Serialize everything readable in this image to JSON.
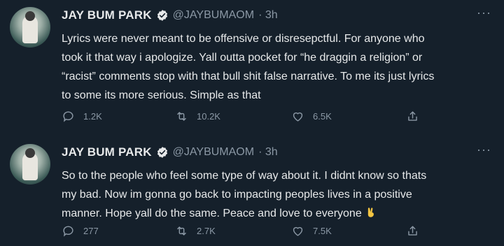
{
  "tweets": [
    {
      "name": "JAY BUM PARK",
      "handle": "@JAYBUMAOM",
      "time": "· 3h",
      "more": "···",
      "lines": [
        "Lyrics were never meant to be offensive or disresepctful. For anyone who",
        "took it that way i apologize. Yall outta pocket for “he draggin a religion” or",
        "“racist” comments stop with that bull shit false narrative. To me its just lyrics",
        "to some its more serious. Simple as that"
      ],
      "replies": "1.2K",
      "retweets": "10.2K",
      "likes": "6.5K"
    },
    {
      "name": "JAY BUM PARK",
      "handle": "@JAYBUMAOM",
      "time": "· 3h",
      "more": "···",
      "lines": [
        "So to the people who feel some type of way about it. I didnt know so thats",
        "my bad. Now im gonna go back to impacting peoples lives in a positive",
        "manner. Hope yall do the same. Peace and love to everyone"
      ],
      "replies": "277",
      "retweets": "2.7K",
      "likes": "7.5K"
    }
  ],
  "icons": {
    "verified": "verified-badge-icon",
    "reply": "reply-icon",
    "retweet": "retweet-icon",
    "like": "heart-icon",
    "share": "share-icon",
    "emoji": "victory-hand-emoji"
  },
  "colors": {
    "background": "#15202b",
    "text": "#e7e9ea",
    "secondary": "#8b98a5",
    "verified": "#e7e9ea"
  }
}
